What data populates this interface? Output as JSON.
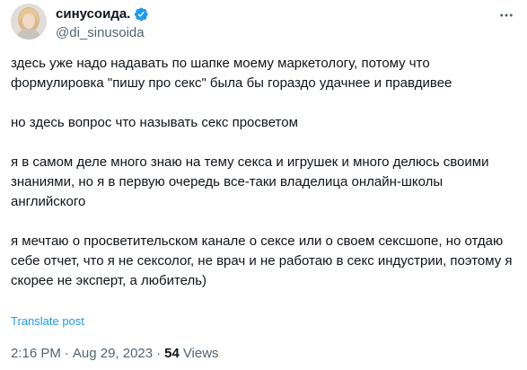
{
  "author": {
    "display_name": "синусоида.",
    "handle": "@di_sinusoida",
    "verified_icon": "verified-badge-icon",
    "accent_color": "#1d9bf0"
  },
  "paragraphs": [
    "здесь уже надо надавать по шапке моему маркетологу, потому что формулировка \"пишу про секс\" была бы гораздо удачнее и правдивее",
    "но здесь вопрос что называть секс просветом",
    "я в самом деле много знаю на тему секса и игрушек и много делюсь своими знаниями, но я в первую очередь все-таки владелица онлайн-школы английского",
    "я мечтаю о просветительском канале о сексе или о своем сексшопе, но отдаю себе отчет, что я не сексолог, не врач и не работаю в секс индустрии, поэтому я скорее не эксперт, а любитель)"
  ],
  "translate_label": "Translate post",
  "meta": {
    "time": "2:16 PM",
    "separator": "·",
    "date": "Aug 29, 2023",
    "views_count": "54",
    "views_label": "Views"
  },
  "icons": {
    "more": "more-options-icon"
  }
}
